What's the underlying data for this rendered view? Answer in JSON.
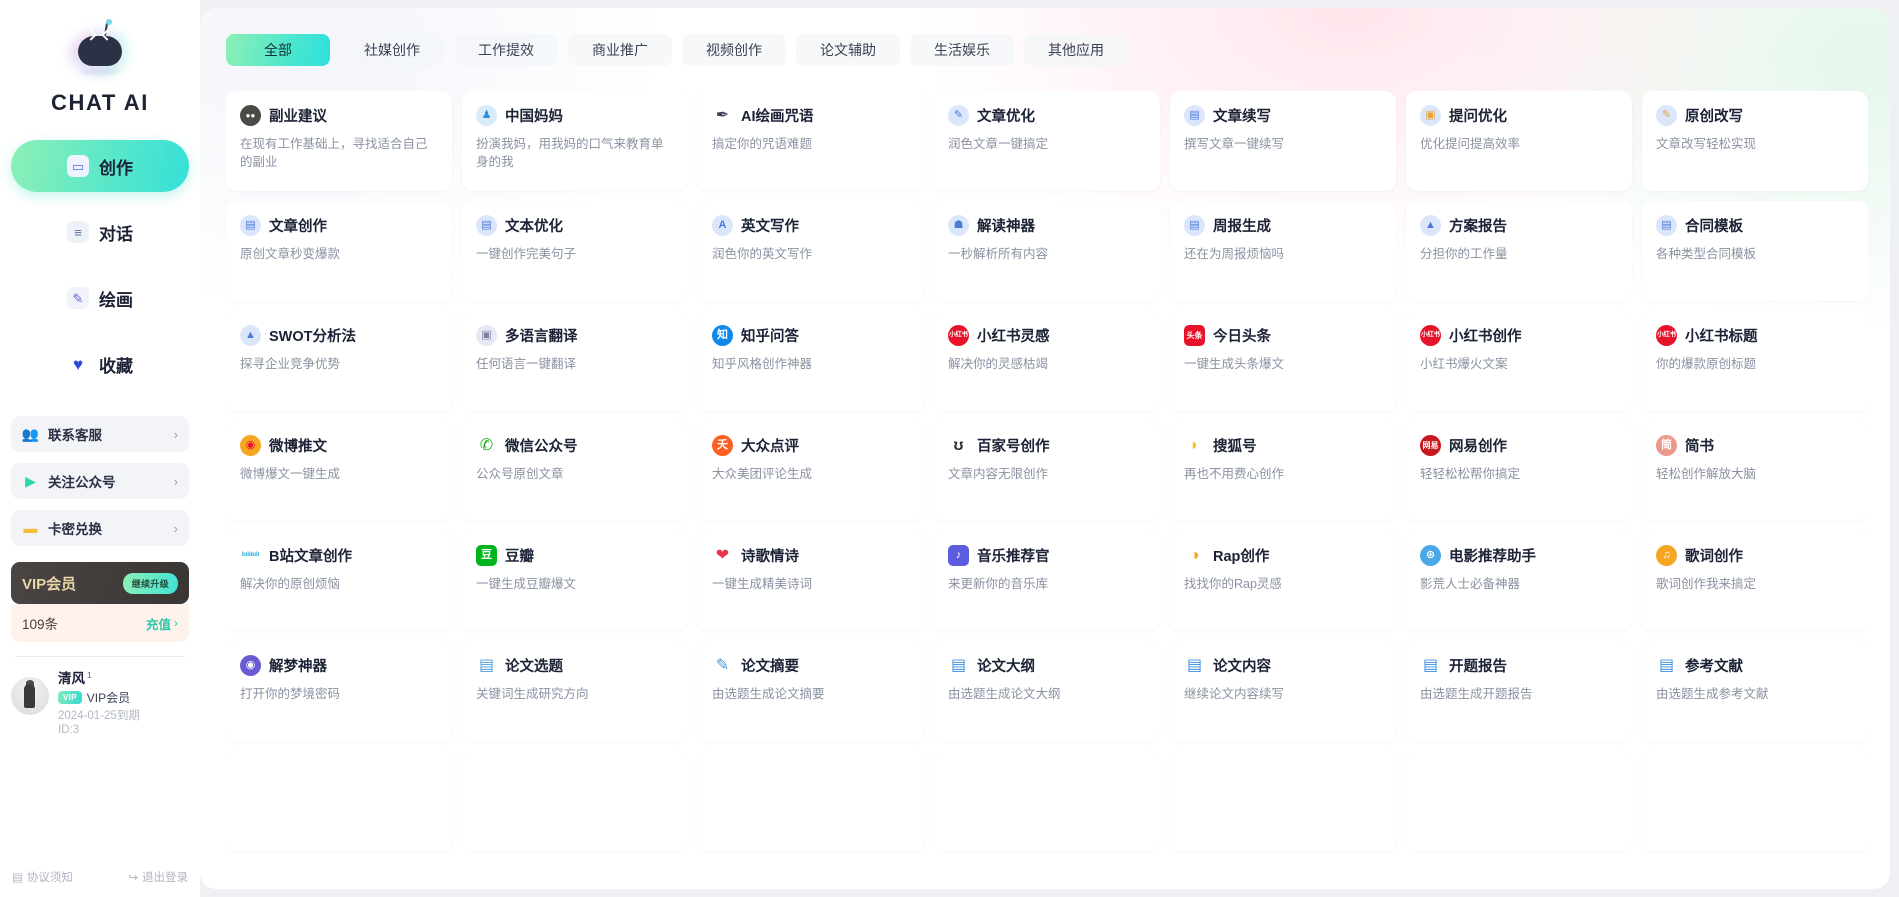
{
  "sidebar": {
    "brand": "CHAT AI",
    "logo_icon": "robot-logo",
    "nav": [
      {
        "label": "创作",
        "icon": "robot-icon",
        "active": true
      },
      {
        "label": "对话",
        "icon": "chat-bubble-icon",
        "active": false
      },
      {
        "label": "绘画",
        "icon": "paint-brush-icon",
        "active": false
      },
      {
        "label": "收藏",
        "icon": "heart-icon",
        "active": false
      }
    ],
    "links": [
      {
        "label": "联系客服",
        "icon": "customer-service-icon",
        "chevron": "›"
      },
      {
        "label": "关注公众号",
        "icon": "wechat-official-icon",
        "chevron": "›"
      },
      {
        "label": "卡密兑换",
        "icon": "card-redeem-icon",
        "chevron": "›"
      }
    ],
    "vip": {
      "title": "VIP会员",
      "button": "继续升级"
    },
    "quota": {
      "count": "109条",
      "action": "充值",
      "chevron": "›"
    },
    "user": {
      "name": "清风",
      "level": "1",
      "badge": "VIP",
      "membership": "VIP会员",
      "expiry": "2024-01-25到期",
      "id": "ID:3",
      "avatar_icon": "user-avatar"
    },
    "footer": [
      {
        "label": "协议须知",
        "icon": "document-icon"
      },
      {
        "label": "退出登录",
        "icon": "logout-icon"
      }
    ]
  },
  "tabs": [
    {
      "label": "全部",
      "active": true
    },
    {
      "label": "社媒创作",
      "active": false
    },
    {
      "label": "工作提效",
      "active": false
    },
    {
      "label": "商业推广",
      "active": false
    },
    {
      "label": "视频创作",
      "active": false
    },
    {
      "label": "论文辅助",
      "active": false
    },
    {
      "label": "生活娱乐",
      "active": false
    },
    {
      "label": "其他应用",
      "active": false
    }
  ],
  "colors": {
    "accent_start": "#8df0b6",
    "accent_end": "#2fe0dc",
    "title": "#1b2235",
    "desc": "#8a91a2",
    "vip_gold": "#e8d6a8",
    "sidebar_bg": "#ffffff"
  },
  "cards": [
    {
      "title": "副业建议",
      "desc": "在现有工作基础上，寻找适合自己的副业",
      "icon": "mask-icon",
      "glyph": "●●",
      "bg": "#4a4a46",
      "fg": "#ffffff",
      "shape": "circle"
    },
    {
      "title": "中国妈妈",
      "desc": "扮演我妈，用我妈的口气来教育单身的我",
      "icon": "person-avatar-icon",
      "glyph": "♟",
      "bg": "#d9eaf8",
      "fg": "#2f8fd8",
      "shape": "circle"
    },
    {
      "title": "AI绘画咒语",
      "desc": "搞定你的咒语难题",
      "icon": "feather-icon",
      "glyph": "✒",
      "bg": "transparent",
      "fg": "#3c4354",
      "shape": "plain"
    },
    {
      "title": "文章优化",
      "desc": "润色文章一键搞定",
      "icon": "edit-doc-icon",
      "glyph": "✎",
      "bg": "#dce6fb",
      "fg": "#4a7ad8",
      "shape": "circle"
    },
    {
      "title": "文章续写",
      "desc": "撰写文章一键续写",
      "icon": "doc-check-icon",
      "glyph": "▤",
      "bg": "#dce6fb",
      "fg": "#4a7ad8",
      "shape": "circle"
    },
    {
      "title": "提问优化",
      "desc": "优化提问提高效率",
      "icon": "question-image-icon",
      "glyph": "▣",
      "bg": "#dce6fb",
      "fg": "#e8a33d",
      "shape": "circle"
    },
    {
      "title": "原创改写",
      "desc": "文章改写轻松实现",
      "icon": "rewrite-icon",
      "glyph": "✎",
      "bg": "#dce6fb",
      "fg": "#e8a33d",
      "shape": "circle"
    },
    {
      "title": "文章创作",
      "desc": "原创文章秒变爆款",
      "icon": "doc-write-icon",
      "glyph": "▤",
      "bg": "#dce6fb",
      "fg": "#4a7ad8",
      "shape": "circle"
    },
    {
      "title": "文本优化",
      "desc": "一键创作完美句子",
      "icon": "doc-pencil-icon",
      "glyph": "▤",
      "bg": "#dce6fb",
      "fg": "#4a7ad8",
      "shape": "circle"
    },
    {
      "title": "英文写作",
      "desc": "润色你的英文写作",
      "icon": "letter-a-icon",
      "glyph": "A",
      "bg": "#dce6fb",
      "fg": "#4a7ad8",
      "shape": "circle"
    },
    {
      "title": "解读神器",
      "desc": "一秒解析所有内容",
      "icon": "lamp-icon",
      "glyph": "☗",
      "bg": "#dce6fb",
      "fg": "#4a7ad8",
      "shape": "circle"
    },
    {
      "title": "周报生成",
      "desc": "还在为周报烦恼吗",
      "icon": "report-chart-icon",
      "glyph": "▤",
      "bg": "#dce6fb",
      "fg": "#4a7ad8",
      "shape": "circle"
    },
    {
      "title": "方案报告",
      "desc": "分担你的工作量",
      "icon": "presentation-icon",
      "glyph": "▲",
      "bg": "#dce6fb",
      "fg": "#4a7ad8",
      "shape": "circle"
    },
    {
      "title": "合同模板",
      "desc": "各种类型合同模板",
      "icon": "contract-icon",
      "glyph": "▤",
      "bg": "#dce6fb",
      "fg": "#4a7ad8",
      "shape": "circle"
    },
    {
      "title": "SWOT分析法",
      "desc": "探寻企业竞争优势",
      "icon": "analysis-icon",
      "glyph": "▲",
      "bg": "#dce6fb",
      "fg": "#4a7ad8",
      "shape": "circle"
    },
    {
      "title": "多语言翻译",
      "desc": "任何语言一键翻译",
      "icon": "translate-icon",
      "glyph": "▣",
      "bg": "#e6e9f5",
      "fg": "#7b83a0",
      "shape": "circle"
    },
    {
      "title": "知乎问答",
      "desc": "知乎风格创作神器",
      "icon": "zhihu-icon",
      "glyph": "知",
      "bg": "#0f88eb",
      "fg": "#ffffff",
      "shape": "circle"
    },
    {
      "title": "小红书灵感",
      "desc": "解决你的灵感枯竭",
      "icon": "xiaohongshu-icon",
      "glyph": "小红书",
      "bg": "#e8122a",
      "fg": "#ffffff",
      "shape": "circle"
    },
    {
      "title": "今日头条",
      "desc": "一键生成头条爆文",
      "icon": "toutiao-icon",
      "glyph": "头条",
      "bg": "#e8122a",
      "fg": "#ffffff",
      "shape": "square"
    },
    {
      "title": "小红书创作",
      "desc": "小红书爆火文案",
      "icon": "xiaohongshu-icon",
      "glyph": "小红书",
      "bg": "#e8122a",
      "fg": "#ffffff",
      "shape": "circle"
    },
    {
      "title": "小红书标题",
      "desc": "你的爆款原创标题",
      "icon": "xiaohongshu-icon",
      "glyph": "小红书",
      "bg": "#e8122a",
      "fg": "#ffffff",
      "shape": "circle"
    },
    {
      "title": "微博推文",
      "desc": "微博爆文一键生成",
      "icon": "weibo-icon",
      "glyph": "◉",
      "bg": "#f5a623",
      "fg": "#e8122a",
      "shape": "circle"
    },
    {
      "title": "微信公众号",
      "desc": "公众号原创文章",
      "icon": "wechat-icon",
      "glyph": "✆",
      "bg": "transparent",
      "fg": "#1aad19",
      "shape": "plain"
    },
    {
      "title": "大众点评",
      "desc": "大众美团评论生成",
      "icon": "dianping-icon",
      "glyph": "夭",
      "bg": "#ff6022",
      "fg": "#ffffff",
      "shape": "circle"
    },
    {
      "title": "百家号创作",
      "desc": "文章内容无限创作",
      "icon": "baijiahao-icon",
      "glyph": "ʊ",
      "bg": "transparent",
      "fg": "#2b2b2b",
      "shape": "plain"
    },
    {
      "title": "搜狐号",
      "desc": "再也不用费心创作",
      "icon": "sohu-icon",
      "glyph": "◗",
      "bg": "transparent",
      "fg": "#f5c518",
      "shape": "plain"
    },
    {
      "title": "网易创作",
      "desc": "轻轻松松帮你搞定",
      "icon": "netease-icon",
      "glyph": "网易",
      "bg": "#c8181e",
      "fg": "#ffffff",
      "shape": "circle"
    },
    {
      "title": "简书",
      "desc": "轻松创作解放大脑",
      "icon": "jianshu-icon",
      "glyph": "简",
      "bg": "#ea9a8c",
      "fg": "#ffffff",
      "shape": "circle"
    },
    {
      "title": "B站文章创作",
      "desc": "解决你的原创烦恼",
      "icon": "bilibili-icon",
      "glyph": "bılıbılı",
      "bg": "transparent",
      "fg": "#2ab0e0",
      "shape": "plain"
    },
    {
      "title": "豆瓣",
      "desc": "一键生成豆瓣爆文",
      "icon": "douban-icon",
      "glyph": "豆",
      "bg": "#00b51d",
      "fg": "#ffffff",
      "shape": "square"
    },
    {
      "title": "诗歌情诗",
      "desc": "一键生成精美诗词",
      "icon": "heart-icon",
      "glyph": "❤",
      "bg": "transparent",
      "fg": "#e8344a",
      "shape": "plain"
    },
    {
      "title": "音乐推荐官",
      "desc": "来更新你的音乐库",
      "icon": "music-icon",
      "glyph": "♪",
      "bg": "#5b5ce0",
      "fg": "#ffffff",
      "shape": "square"
    },
    {
      "title": "Rap创作",
      "desc": "找找你的Rap灵感",
      "icon": "microphone-icon",
      "glyph": "◑",
      "bg": "transparent",
      "fg": "#f5a623",
      "shape": "plain"
    },
    {
      "title": "电影推荐助手",
      "desc": "影荒人士必备神器",
      "icon": "film-reel-icon",
      "glyph": "⊛",
      "bg": "#4aa8e8",
      "fg": "#ffffff",
      "shape": "circle"
    },
    {
      "title": "歌词创作",
      "desc": "歌词创作我来搞定",
      "icon": "lyrics-icon",
      "glyph": "♫",
      "bg": "#f5a623",
      "fg": "#ffffff",
      "shape": "circle"
    },
    {
      "title": "解梦神器",
      "desc": "打开你的梦境密码",
      "icon": "dream-icon",
      "glyph": "◉",
      "bg": "#6a5bd4",
      "fg": "#ffffff",
      "shape": "circle"
    },
    {
      "title": "论文选题",
      "desc": "关键词生成研究方向",
      "icon": "paper-topic-icon",
      "glyph": "▤",
      "bg": "transparent",
      "fg": "#4a9ad8",
      "shape": "plain"
    },
    {
      "title": "论文摘要",
      "desc": "由选题生成论文摘要",
      "icon": "paper-abstract-icon",
      "glyph": "✎",
      "bg": "transparent",
      "fg": "#4a9ad8",
      "shape": "plain"
    },
    {
      "title": "论文大纲",
      "desc": "由选题生成论文大纲",
      "icon": "paper-outline-icon",
      "glyph": "▤",
      "bg": "transparent",
      "fg": "#3f8fe0",
      "shape": "plain"
    },
    {
      "title": "论文内容",
      "desc": "继续论文内容续写",
      "icon": "paper-content-icon",
      "glyph": "▤",
      "bg": "transparent",
      "fg": "#3f8fe0",
      "shape": "plain"
    },
    {
      "title": "开题报告",
      "desc": "由选题生成开题报告",
      "icon": "paper-proposal-icon",
      "glyph": "▤",
      "bg": "transparent",
      "fg": "#3f8fe0",
      "shape": "plain"
    },
    {
      "title": "参考文献",
      "desc": "由选题生成参考文献",
      "icon": "paper-reference-icon",
      "glyph": "▤",
      "bg": "transparent",
      "fg": "#3f8fe0",
      "shape": "plain"
    }
  ]
}
